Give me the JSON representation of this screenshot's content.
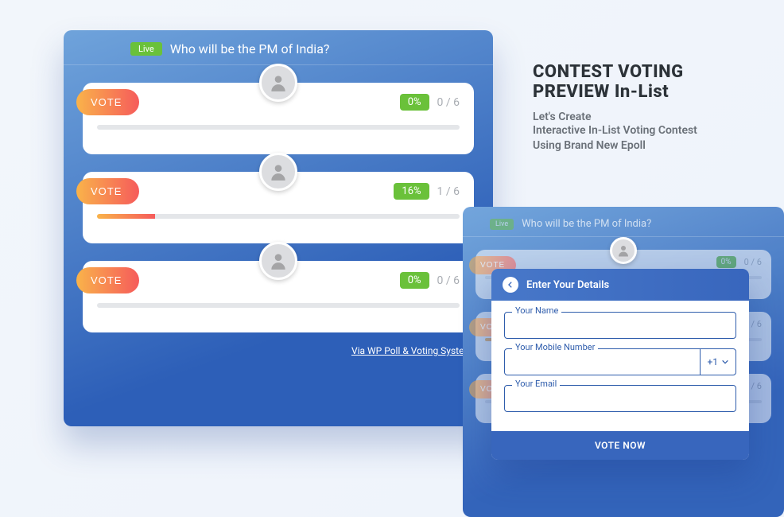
{
  "heading": {
    "line1": "CONTEST VOTING",
    "line2": "PREVIEW  In-List",
    "sub1": "Let's Create",
    "sub2": "Interactive In-List Voting Contest",
    "sub3": "Using Brand New Epoll"
  },
  "poll": {
    "live_label": "Live",
    "title": "Who will be the PM of India?",
    "vote_label": "VOTE",
    "footer": "Via WP Poll & Voting System",
    "options": [
      {
        "avatar": "person-1",
        "percent": "0%",
        "count": "0 / 6",
        "fill": 0
      },
      {
        "avatar": "person-2",
        "percent": "16%",
        "count": "1 / 6",
        "fill": 16
      },
      {
        "avatar": "person-3",
        "percent": "0%",
        "count": "0 / 6",
        "fill": 0
      }
    ]
  },
  "modal": {
    "title": "Enter Your Details",
    "name_label": "Your Name",
    "mobile_label": "Your Mobile Number",
    "dial_code": "+1",
    "email_label": "Your Email",
    "submit": "VOTE NOW"
  }
}
